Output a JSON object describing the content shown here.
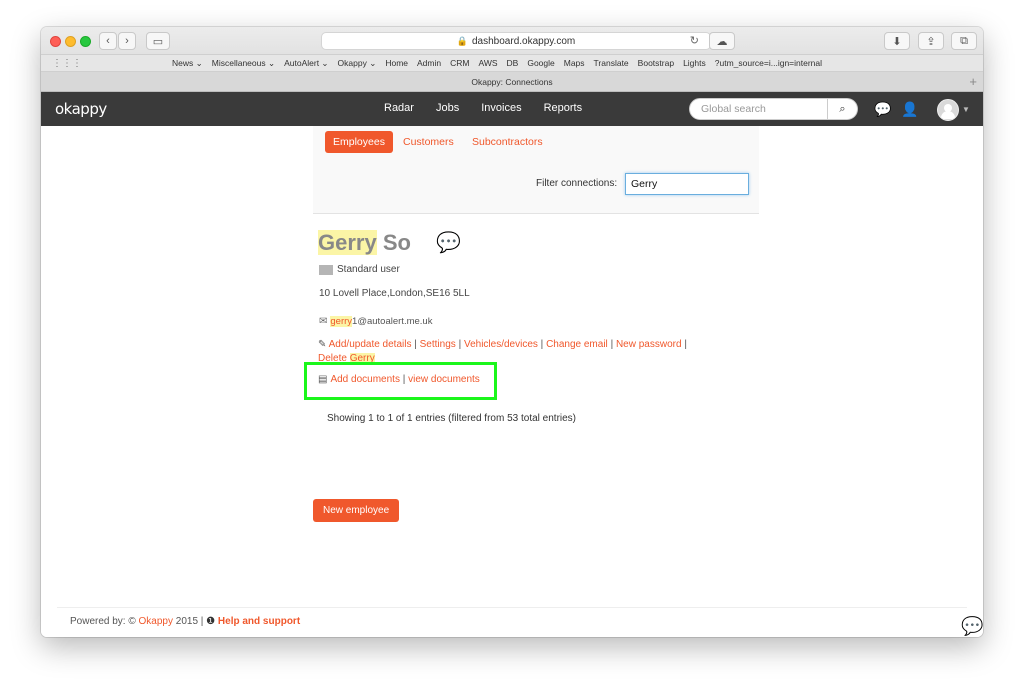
{
  "browser": {
    "url": "dashboard.okappy.com",
    "tab_title": "Okappy: Connections",
    "bookmarks": [
      "News ⌄",
      "Miscellaneous ⌄",
      "AutoAlert ⌄",
      "Okappy ⌄",
      "Home",
      "Admin",
      "CRM",
      "AWS",
      "DB",
      "Google",
      "Maps",
      "Translate",
      "Bootstrap",
      "Lights",
      "?utm_source=i...ign=internal"
    ]
  },
  "app": {
    "logo": "okappy",
    "nav": [
      "Radar",
      "Jobs",
      "Invoices",
      "Reports"
    ],
    "search_placeholder": "Global search"
  },
  "tabs": {
    "employees": "Employees",
    "customers": "Customers",
    "subcontractors": "Subcontractors"
  },
  "filter": {
    "label": "Filter connections:",
    "value": "Gerry"
  },
  "person": {
    "first_name": "Gerry",
    "last_name": "So",
    "role": "Standard user",
    "address": "10 Lovell Place,London,SE16 5LL",
    "email_highlight": "gerry",
    "email_rest": "1@autoalert.me.uk"
  },
  "actions": {
    "add_update": "Add/update details",
    "settings": "Settings",
    "vehicles": "Vehicles/devices",
    "change_email": "Change email",
    "new_password": "New password",
    "delete_prefix": "Delete ",
    "delete_name": "Gerry"
  },
  "documents": {
    "add": "Add documents",
    "view": "view documents"
  },
  "table_info": "Showing 1 to 1 of 1 entries (filtered from 53 total entries)",
  "new_employee_label": "New employee",
  "footer": {
    "prefix": "Powered by: © ",
    "brand": "Okappy",
    "year": " 2015 | ",
    "help": "Help and support"
  },
  "colors": {
    "accent": "#f0582c",
    "highlight_box": "#1bf61b",
    "nav_bg": "#3a3a3a"
  }
}
